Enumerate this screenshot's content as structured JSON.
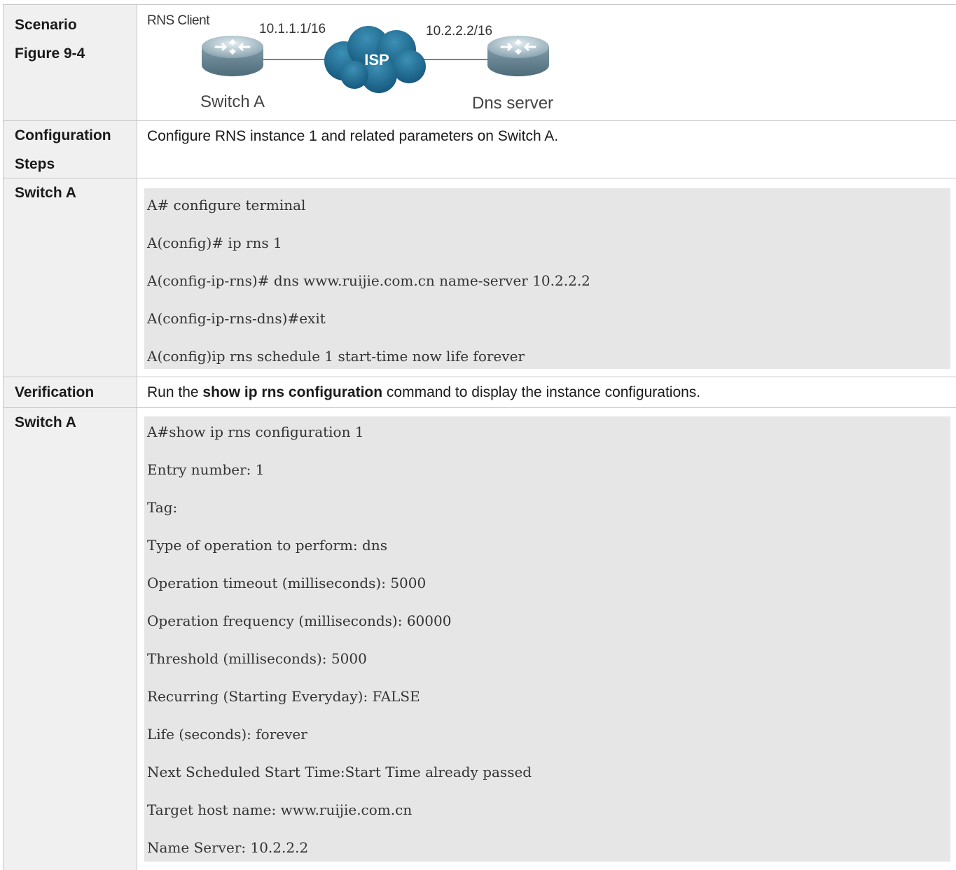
{
  "rows": {
    "scenario": {
      "label_1": "Scenario",
      "label_2": "Figure 9-4",
      "diagram": {
        "rns_client": "RNS Client",
        "ip_left": "10.1.1.1/16",
        "ip_right": "10.2.2.2/16",
        "isp": "ISP",
        "switch_a": "Switch A",
        "dns_server": "Dns server"
      }
    },
    "config_steps": {
      "label_1": "Configuration",
      "label_2": "Steps",
      "text": "Configure RNS instance 1 and related parameters on Switch A."
    },
    "switch_a_config": {
      "label": "Switch A",
      "lines": [
        "A# configure terminal",
        "A(config)# ip rns 1",
        "A(config-ip-rns)# dns www.ruijie.com.cn name-server 10.2.2.2",
        "A(config-ip-rns-dns)#exit",
        "A(config)ip rns schedule 1 start-time now life forever"
      ]
    },
    "verification": {
      "label": "Verification",
      "text_prefix": "Run the ",
      "text_bold": "show ip rns configuration",
      "text_suffix": " command to display the instance configurations."
    },
    "switch_a_show": {
      "label": "Switch A",
      "lines": [
        "A#show ip rns configuration 1",
        "Entry number: 1",
        "Tag:",
        "Type of operation to perform: dns",
        "Operation timeout (milliseconds): 5000",
        "Operation frequency (milliseconds): 60000",
        "Threshold (milliseconds): 5000",
        "Recurring (Starting Everyday): FALSE",
        "Life (seconds): forever",
        "Next Scheduled Start Time:Start Time already passed",
        "Target host name: www.ruijie.com.cn",
        "Name Server: 10.2.2.2"
      ]
    }
  }
}
